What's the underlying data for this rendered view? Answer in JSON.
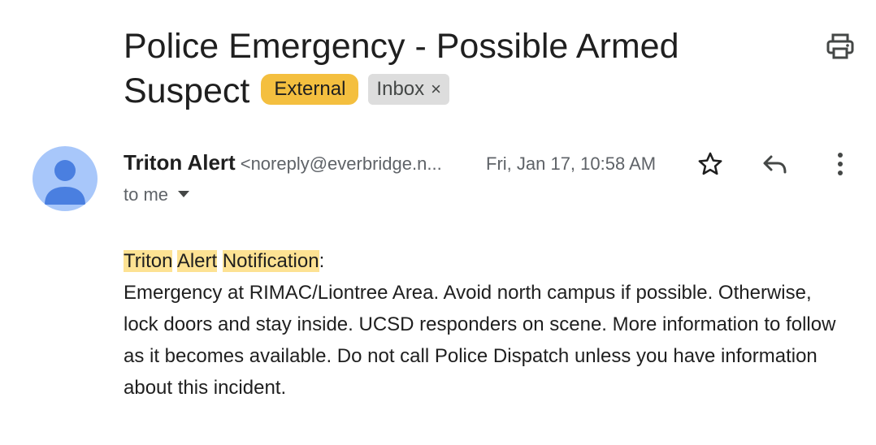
{
  "email": {
    "subject": "Police Emergency - Possible Armed Suspect",
    "labels": {
      "external": "External",
      "inbox": "Inbox",
      "inbox_remove": "×"
    },
    "sender": {
      "name": "Triton Alert",
      "email": "<noreply@everbridge.n..."
    },
    "date": "Fri, Jan 17, 10:58 AM",
    "recipient": "to me",
    "body": {
      "highlight_words": [
        "Triton",
        "Alert",
        "Notification"
      ],
      "colon": ":",
      "text": "Emergency at RIMAC/Liontree Area. Avoid north campus if possible. Otherwise, lock doors and stay inside. UCSD responders on scene. More information to follow as it becomes available. Do not call Police Dispatch unless you have information about this incident."
    }
  },
  "icons": {
    "print": "print-icon",
    "star": "star-icon",
    "reply": "reply-icon",
    "more": "more-vert-icon",
    "avatar": "person-icon",
    "caret": "chevron-down-icon"
  },
  "colors": {
    "external_chip": "#f4bf3f",
    "inbox_chip": "#dddddd",
    "highlight": "#fde293",
    "avatar_bg": "#a8c7fa",
    "avatar_fg": "#4a7fe0"
  }
}
